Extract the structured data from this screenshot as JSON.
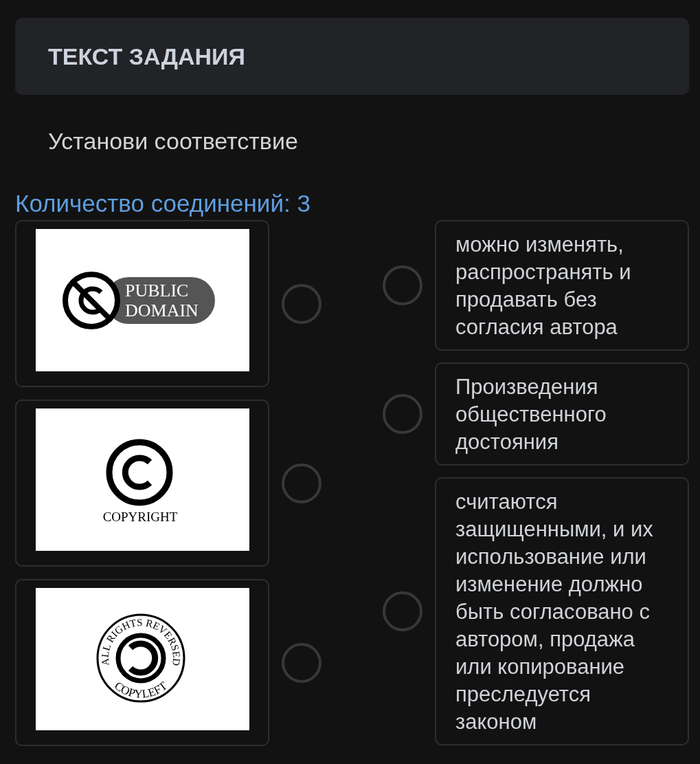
{
  "task_header": {
    "title": "ТЕКСТ ЗАДАНИЯ"
  },
  "instruction": "Установи соответствие",
  "connections_count": "Количество соединений: 3",
  "left_items": [
    {
      "kind": "public_domain",
      "image_texts": [
        "PUBLIC",
        "DOMAIN"
      ]
    },
    {
      "kind": "copyright",
      "image_texts": [
        "COPYRIGHT"
      ]
    },
    {
      "kind": "copyleft",
      "image_texts": [
        "ALL RIGHTS REVERSED",
        "COPYLEFT"
      ]
    }
  ],
  "right_items": [
    {
      "text": "можно изменять, распространять и продавать без согласия автора"
    },
    {
      "text": "Произведения общественного достояния"
    },
    {
      "text": "считаются защищенными, и их использование или изменение должно быть согласовано с автором, продажа или копирование преследуется законом"
    }
  ]
}
